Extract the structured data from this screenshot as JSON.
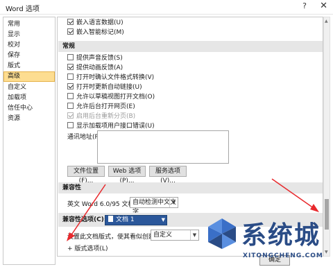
{
  "window": {
    "title": "Word 选项",
    "help_icon": "?",
    "close_icon": "✕"
  },
  "sidebar": {
    "items": [
      {
        "label": "常用"
      },
      {
        "label": "显示"
      },
      {
        "label": "校对"
      },
      {
        "label": "保存"
      },
      {
        "label": "版式"
      },
      {
        "label": "高级",
        "active": true
      },
      {
        "label": "自定义"
      },
      {
        "label": "加载项"
      },
      {
        "label": "信任中心"
      },
      {
        "label": "资源"
      }
    ]
  },
  "content": {
    "top_checks": [
      {
        "label": "嵌入语言数据(U)",
        "checked": true
      },
      {
        "label": "嵌入智能标记(M)",
        "checked": true
      }
    ],
    "general_section": "常规",
    "general_checks": [
      {
        "label": "提供声音反馈(S)",
        "checked": false
      },
      {
        "label": "提供动画反馈(A)",
        "checked": true
      },
      {
        "label": "打开时确认文件格式转换(V)",
        "checked": false
      },
      {
        "label": "打开时更新自动链接(U)",
        "checked": true
      },
      {
        "label": "允许以草稿视图打开文档(O)",
        "checked": false
      },
      {
        "label": "允许后台打开网页(E)",
        "checked": false
      },
      {
        "label": "启用后台重新分页(B)",
        "checked": true,
        "disabled": true
      },
      {
        "label": "显示加载项用户接口错误(U)",
        "checked": false
      }
    ],
    "mailing_address_label": "通讯地址(R):",
    "buttons": {
      "file_locations": "文件位置(F)...",
      "web_options": "Web 选项(P)...",
      "service_options": "服务选项(V)..."
    },
    "compat_section": "兼容性",
    "compat_word_label": "英文 Word 6.0/95 文档(L):",
    "compat_word_value": "自动检测中文文字",
    "compat_options_label": "兼容性选项(C):",
    "compat_options_doc": "文档 1",
    "layout_as_label": "设置此文档版式，使其看似创建于(U):",
    "layout_as_value": "自定义",
    "layout_options_label": "版式选项(L)",
    "layout_options_expander": "+"
  },
  "footer": {
    "ok_label": "确定"
  },
  "watermark": {
    "text": "系统城",
    "sub": "XITONGCHENG.COM"
  },
  "colors": {
    "accent_blue": "#2b579a",
    "active_item": "#fddd91",
    "arrow_red": "#e8292d",
    "watermark_blue": "#2a4c86"
  }
}
